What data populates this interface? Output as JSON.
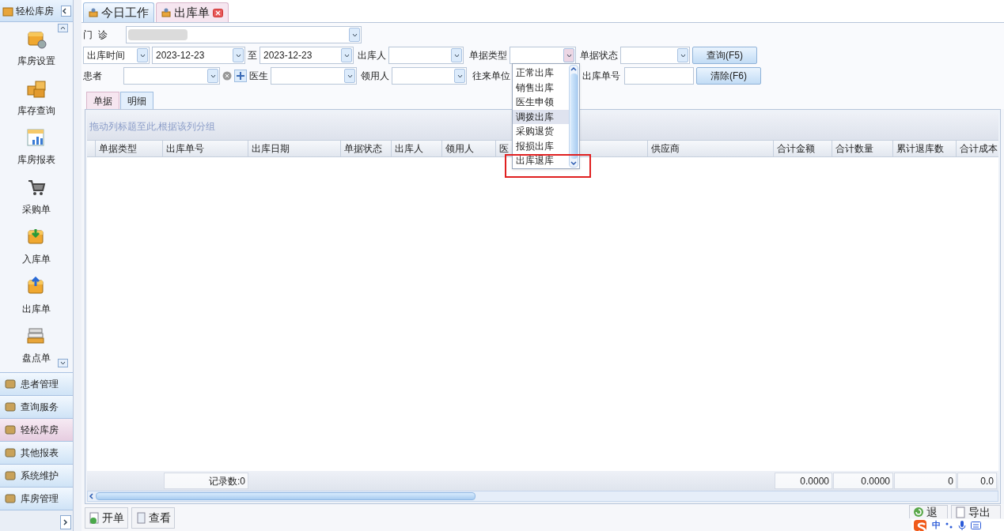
{
  "sidebar": {
    "title": "轻松库房",
    "modules": [
      {
        "label": "库房设置"
      },
      {
        "label": "库存查询"
      },
      {
        "label": "库房报表"
      },
      {
        "label": "采购单"
      },
      {
        "label": "入库单"
      },
      {
        "label": "出库单"
      },
      {
        "label": "盘点单"
      }
    ],
    "nav": [
      {
        "label": "患者管理",
        "selected": false
      },
      {
        "label": "查询服务",
        "selected": false
      },
      {
        "label": "轻松库房",
        "selected": true
      },
      {
        "label": "其他报表",
        "selected": false
      },
      {
        "label": "系统维护",
        "selected": false
      },
      {
        "label": "库房管理",
        "selected": false
      }
    ]
  },
  "tabs": [
    {
      "label": "今日工作",
      "selected": false,
      "closable": false
    },
    {
      "label": "出库单",
      "selected": true,
      "closable": true
    }
  ],
  "filters": {
    "clinic_label": "门  诊",
    "time_type": "出库时间",
    "date_from": "2023-12-23",
    "to_label": "至",
    "date_to": "2023-12-23",
    "issuer_label": "出库人",
    "doc_type_label": "单据类型",
    "doc_status_label": "单据状态",
    "query_button": "查询(F5)",
    "patient_label": "患者",
    "doctor_label": "医生",
    "receiver_label": "领用人",
    "partner_label": "往来单位",
    "doc_no_label": "出库单号",
    "clear_button": "清除(F6)"
  },
  "doc_type_dropdown": {
    "options": [
      {
        "label": "正常出库",
        "selected": false
      },
      {
        "label": "销售出库",
        "selected": false
      },
      {
        "label": "医生申领",
        "selected": false
      },
      {
        "label": "调拨出库",
        "selected": true
      },
      {
        "label": "采购退货",
        "selected": false
      },
      {
        "label": "报损出库",
        "selected": false
      },
      {
        "label": "出库退库",
        "selected": false
      }
    ]
  },
  "sub_tabs": [
    {
      "label": "单据",
      "selected": true
    },
    {
      "label": "明细",
      "selected": false
    }
  ],
  "table": {
    "group_hint": "拖动列标题至此,根据该列分组",
    "columns": [
      "单据类型",
      "出库单号",
      "出库日期",
      "单据状态",
      "出库人",
      "领用人",
      "医",
      "",
      "供应商",
      "合计金额",
      "合计数量",
      "累计退库数",
      "合计成本"
    ],
    "footer": {
      "record_count": "记录数:0",
      "total_amount": "0.0000",
      "total_quantity": "0.0000",
      "total_returned": "0",
      "total_cost": "0.0"
    }
  },
  "toolbar_left": [
    "开单",
    "查看"
  ],
  "toolbar_right": [
    "退",
    "导出"
  ],
  "ime_bar": {
    "label": "中"
  }
}
